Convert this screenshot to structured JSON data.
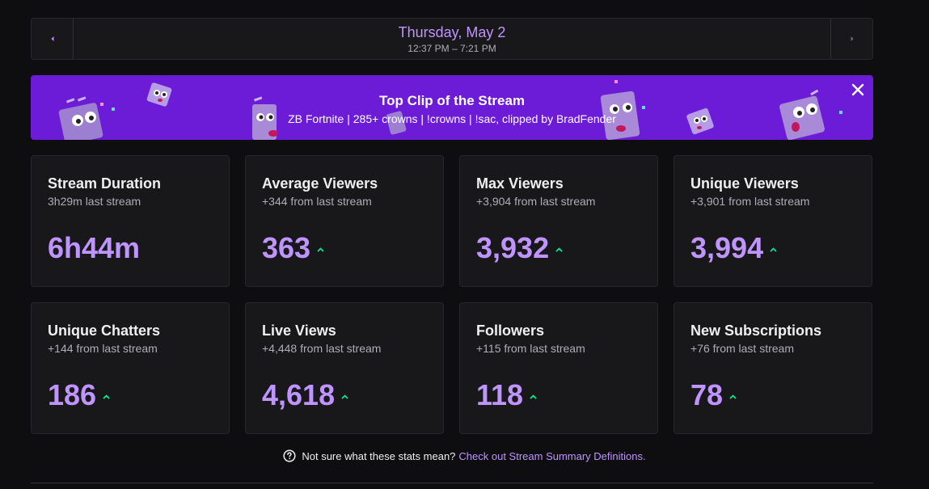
{
  "date_nav": {
    "date": "Thursday, May 2",
    "time_range": "12:37 PM – 7:21 PM"
  },
  "banner": {
    "title": "Top Clip of the Stream",
    "subtitle": "ZB Fortnite | 285+ crowns | !crowns | !sac, clipped by BradFender",
    "background": "#6c1cd6"
  },
  "stats": [
    {
      "title": "Stream Duration",
      "sub": "3h29m last stream",
      "value": "6h44m",
      "trend": "none"
    },
    {
      "title": "Average Viewers",
      "sub": "+344 from last stream",
      "value": "363",
      "trend": "up"
    },
    {
      "title": "Max Viewers",
      "sub": "+3,904 from last stream",
      "value": "3,932",
      "trend": "up"
    },
    {
      "title": "Unique Viewers",
      "sub": "+3,901 from last stream",
      "value": "3,994",
      "trend": "up"
    },
    {
      "title": "Unique Chatters",
      "sub": "+144 from last stream",
      "value": "186",
      "trend": "up"
    },
    {
      "title": "Live Views",
      "sub": "+4,448 from last stream",
      "value": "4,618",
      "trend": "up"
    },
    {
      "title": "Followers",
      "sub": "+115 from last stream",
      "value": "118",
      "trend": "up"
    },
    {
      "title": "New Subscriptions",
      "sub": "+76 from last stream",
      "value": "78",
      "trend": "up"
    }
  ],
  "footer": {
    "question": "Not sure what these stats mean?",
    "link": "Check out Stream Summary Definitions",
    "period": "."
  },
  "colors": {
    "accent": "#bf94ff",
    "trend_up": "#00f593",
    "page_bg": "#0e0e10",
    "card_bg": "#18181b"
  }
}
